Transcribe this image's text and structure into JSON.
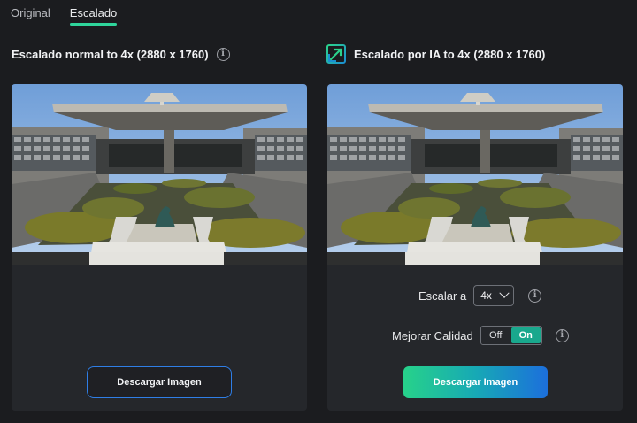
{
  "tabs": [
    {
      "label": "Original",
      "active": false
    },
    {
      "label": "Escalado",
      "active": true
    }
  ],
  "left": {
    "title": "Escalado normal to 4x (2880 x 1760)",
    "download_label": "Descargar Imagen"
  },
  "right": {
    "title": "Escalado por IA to 4x (2880 x 1760)",
    "scale_label": "Escalar a",
    "scale_value": "4x",
    "quality_label": "Mejorar Calidad",
    "toggle_off": "Off",
    "toggle_on": "On",
    "quality_enabled": true,
    "download_label": "Descargar Imagen"
  },
  "colors": {
    "accent": "#2fd59b",
    "button_outline": "#2f7ee6",
    "toggle_on": "#19a88d",
    "gradient_start": "#27d28a",
    "gradient_end": "#1c6fdc"
  },
  "icons": {
    "info": "info-circle-icon",
    "ai_upscale": "expand-arrows-icon",
    "dropdown": "chevron-down-icon"
  }
}
